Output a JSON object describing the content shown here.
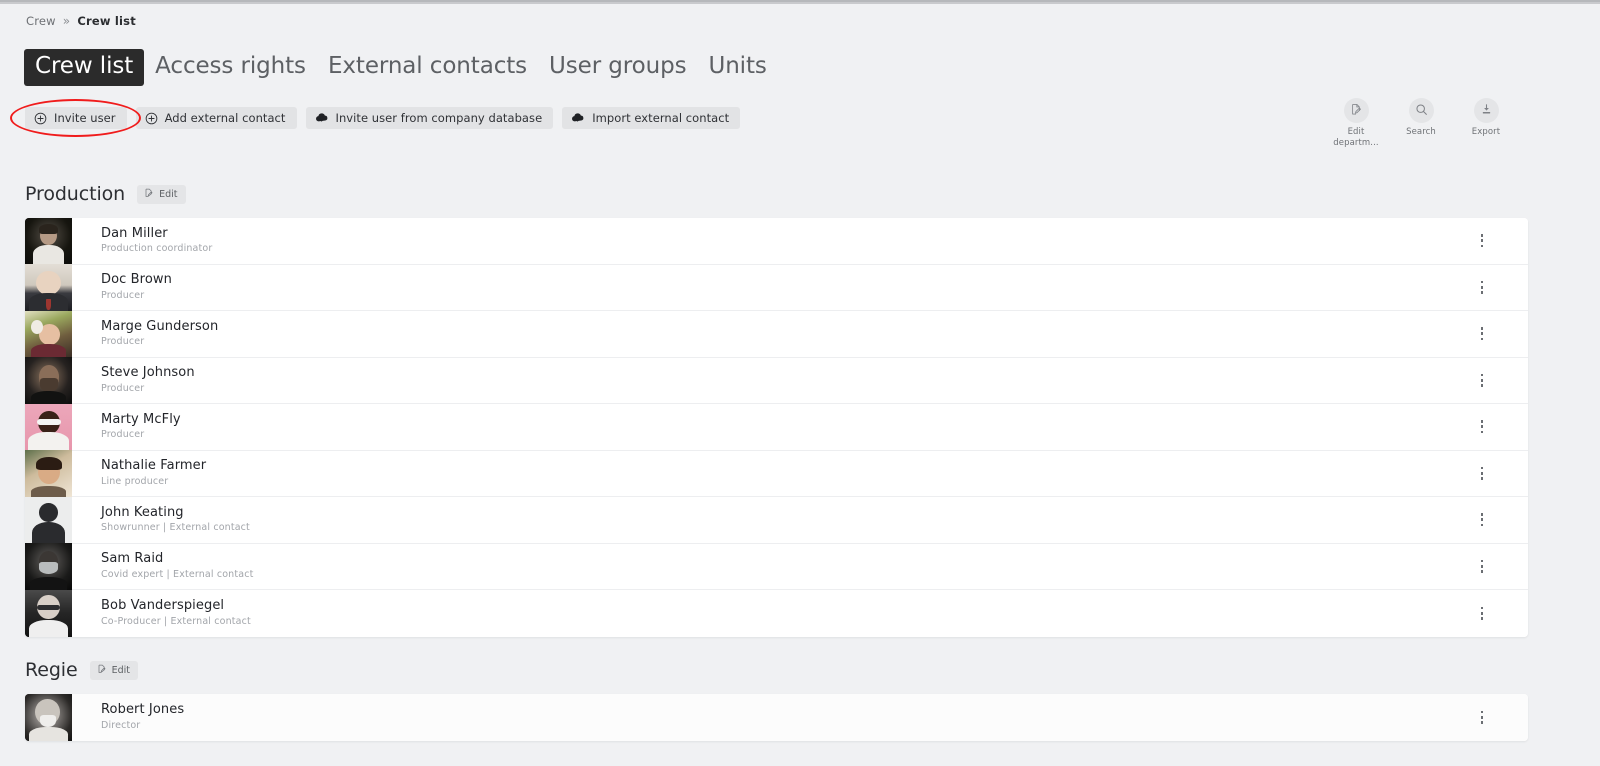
{
  "breadcrumb": {
    "root": "Crew",
    "separator": "»",
    "current": "Crew list"
  },
  "tabs": [
    {
      "label": "Crew list",
      "active": true
    },
    {
      "label": "Access rights",
      "active": false
    },
    {
      "label": "External contacts",
      "active": false
    },
    {
      "label": "User groups",
      "active": false
    },
    {
      "label": "Units",
      "active": false
    }
  ],
  "actions": [
    {
      "label": "Invite user",
      "icon": "plus-circle-icon",
      "highlighted": true
    },
    {
      "label": "Add external contact",
      "icon": "plus-circle-icon",
      "highlighted": false
    },
    {
      "label": "Invite user from company database",
      "icon": "cloud-download-icon",
      "highlighted": false
    },
    {
      "label": "Import external contact",
      "icon": "cloud-download-icon",
      "highlighted": false
    }
  ],
  "tools": [
    {
      "label": "Edit departm...",
      "icon": "edit-document-icon"
    },
    {
      "label": "Search",
      "icon": "search-icon"
    },
    {
      "label": "Export",
      "icon": "download-icon"
    }
  ],
  "annotation": {
    "shape": "ellipse",
    "color": "#f01c1c",
    "targets": "Invite user"
  },
  "edit_chip_label": "Edit",
  "sections": [
    {
      "title": "Production",
      "edit_label": "Edit",
      "members": [
        {
          "name": "Dan Miller",
          "role": "Production coordinator",
          "avatar": "dan-miller"
        },
        {
          "name": "Doc Brown",
          "role": "Producer",
          "avatar": "doc-brown"
        },
        {
          "name": "Marge Gunderson",
          "role": "Producer",
          "avatar": "marge-gunderson"
        },
        {
          "name": "Steve Johnson",
          "role": "Producer",
          "avatar": "steve-johnson"
        },
        {
          "name": "Marty McFly",
          "role": "Producer",
          "avatar": "marty-mcfly"
        },
        {
          "name": "Nathalie Farmer",
          "role": "Line producer",
          "avatar": "nathalie-farmer"
        },
        {
          "name": "John Keating",
          "role": "Showrunner | External contact",
          "avatar": "john-keating"
        },
        {
          "name": "Sam Raid",
          "role": "Covid expert | External contact",
          "avatar": "sam-raid"
        },
        {
          "name": "Bob Vanderspiegel",
          "role": "Co-Producer | External contact",
          "avatar": "bob-vanderspiegel"
        }
      ]
    },
    {
      "title": "Regie",
      "edit_label": "Edit",
      "members": [
        {
          "name": "Robert Jones",
          "role": "Director",
          "avatar": "robert-jones"
        }
      ]
    }
  ],
  "colors": {
    "page_background": "#f0f1f3",
    "row_background": "#ffffff",
    "active_tab_background": "#2b2b2b",
    "button_background": "#e2e3e5",
    "annotation": "#f01c1c"
  }
}
